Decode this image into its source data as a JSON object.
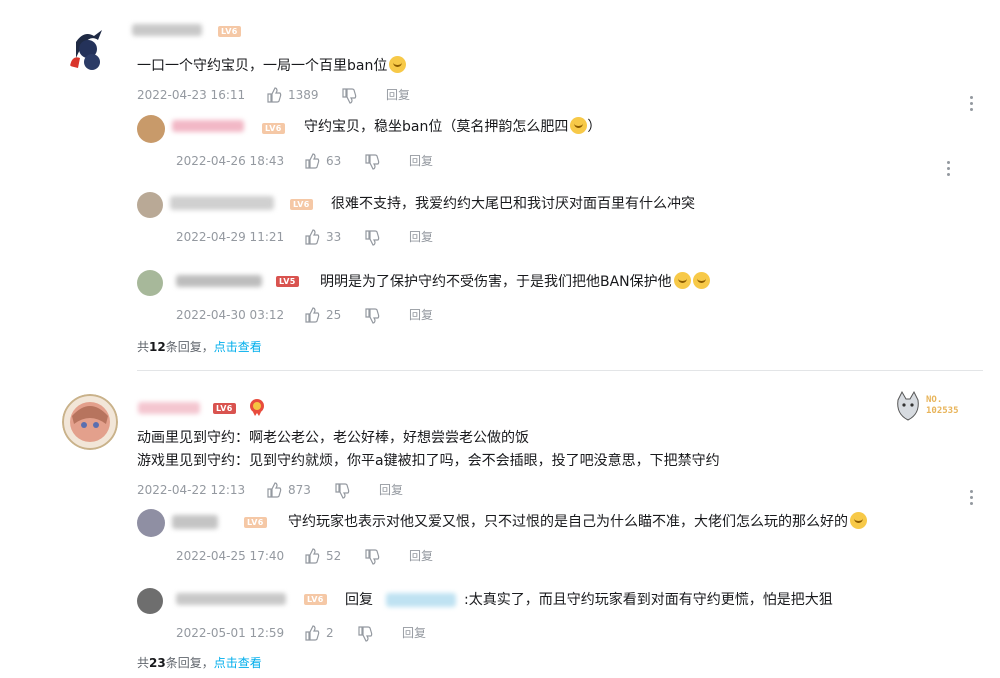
{
  "threads": [
    {
      "level": "LV6",
      "text": "一口一个守约宝贝，一局一个百里ban位",
      "time": "2022-04-23 16:11",
      "likes": "1389",
      "reply_label": "回复",
      "replies": [
        {
          "level": "LV6",
          "text": "守约宝贝，稳坐ban位（莫名押韵怎么肥四",
          "tail": "）",
          "time": "2022-04-26 18:43",
          "likes": "63",
          "reply_label": "回复"
        },
        {
          "level": "LV6",
          "text": "很难不支持，我爱约约大尾巴和我讨厌对面百里有什么冲突",
          "time": "2022-04-29 11:21",
          "likes": "33",
          "reply_label": "回复"
        },
        {
          "level": "LV5",
          "text": "明明是为了保护守约不受伤害，于是我们把他BAN保护他",
          "time": "2022-04-30 03:12",
          "likes": "25",
          "reply_label": "回复"
        }
      ],
      "total_prefix": "共",
      "total_count": "12",
      "total_suffix": "条回复，",
      "view_link": "点击查看"
    },
    {
      "level": "LV6",
      "line1": "动画里见到守约：啊老公老公，老公好棒，好想尝尝老公做的饭",
      "line2": "游戏里见到守约：见到守约就烦，你平a键被扣了吗，会不会插眼，投了吧没意思，下把禁守约",
      "time": "2022-04-22 12:13",
      "likes": "873",
      "reply_label": "回复",
      "badge_label": "NO.",
      "badge_number": "102535",
      "replies": [
        {
          "level": "LV6",
          "text": "守约玩家也表示对他又爱又恨，只不过恨的是自己为什么瞄不准，大佬们怎么玩的那么好的",
          "time": "2022-04-25 17:40",
          "likes": "52",
          "reply_label": "回复"
        },
        {
          "level": "LV6",
          "prefix": "回复",
          "text": ":太真实了，而且守约玩家看到对面有守约更慌，怕是把大狙",
          "time": "2022-05-01 12:59",
          "likes": "2",
          "reply_label": "回复"
        }
      ],
      "total_prefix": "共",
      "total_count": "23",
      "total_suffix": "条回复，",
      "view_link": "点击查看"
    }
  ]
}
